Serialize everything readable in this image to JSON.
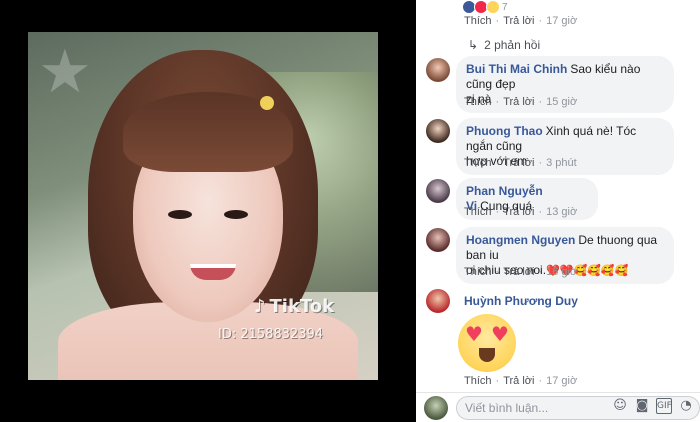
{
  "video": {
    "watermark_brand": "TikTok",
    "watermark_id": "ID: 2158832394"
  },
  "comments_panel": {
    "top_comment": {
      "actions": {
        "like": "Thích",
        "reply": "Trả lời",
        "time": "17 giờ"
      },
      "reaction_count": "7",
      "reply_count_label": "2 phản hồi"
    },
    "comments": [
      {
        "author": "Bui Thi Mai Chinh",
        "text_line1": "Sao kiểu nào cũng đẹp",
        "text_line2": "zị nà",
        "actions": {
          "like": "Thích",
          "reply": "Trả lời",
          "time": "15 giờ"
        }
      },
      {
        "author": "Phuong Thao",
        "text_line1": "Xinh quá nè! Tóc ngắn cũng",
        "text_line2": "hợp với em",
        "actions": {
          "like": "Thích",
          "reply": "Trả lời",
          "time": "3 phút"
        }
      },
      {
        "author": "Phan Nguyễn Vi",
        "text_line1": "Cung quá",
        "actions": {
          "like": "Thích",
          "reply": "Trả lời",
          "time": "13 giờ"
        }
      },
      {
        "author": "Hoangmen Nguyen",
        "text_line1": "De thuong qua ban iu",
        "text_line2": "oi chiu sao noi.",
        "emojis": "❤️❤️🥰🥰🥰🥰",
        "actions": {
          "like": "Thích",
          "reply": "Trả lời",
          "time": "16 giờ"
        }
      },
      {
        "author": "Huỳnh Phương Duy",
        "sticker": "heart-eyes-emoji",
        "actions": {
          "like": "Thích",
          "reply": "Trả lời",
          "time": "17 giờ"
        }
      }
    ],
    "composer": {
      "placeholder": "Viết bình luận...",
      "tool_icons": [
        "smiley-icon",
        "camera-icon",
        "gif-icon",
        "sticker-icon"
      ]
    }
  },
  "colors": {
    "name_link": "#385898",
    "bubble_bg": "#f2f3f5",
    "meta_text": "#90949c"
  }
}
